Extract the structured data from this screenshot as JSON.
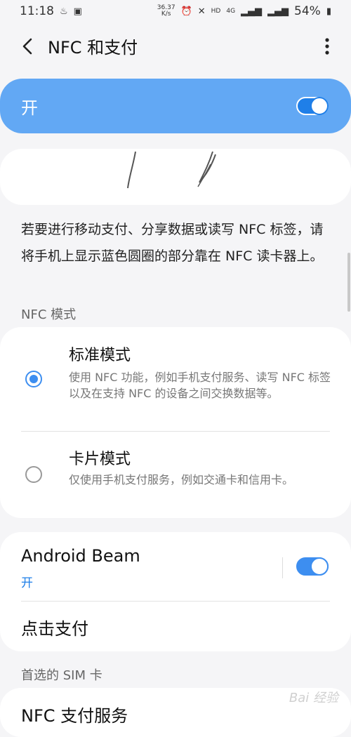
{
  "status_bar": {
    "time": "11:18",
    "net_speed_value": "36.37",
    "net_speed_unit": "K/s",
    "network_hd": "HD",
    "network_4g": "4G",
    "battery": "54%"
  },
  "header": {
    "title": "NFC 和支付"
  },
  "master_toggle": {
    "label": "开",
    "state": "on"
  },
  "description": "若要进行移动支付、分享数据或读写 NFC 标签，请将手机上显示蓝色圆圈的部分靠在 NFC 读卡器上。",
  "nfc_mode": {
    "header": "NFC 模式",
    "options": [
      {
        "title": "标准模式",
        "desc": "使用 NFC 功能，例如手机支付服务、读写 NFC 标签以及在支持 NFC 的设备之间交换数据等。",
        "selected": true
      },
      {
        "title": "卡片模式",
        "desc": "仅使用手机支付服务，例如交通卡和信用卡。",
        "selected": false
      }
    ]
  },
  "android_beam": {
    "title": "Android Beam",
    "status": "开",
    "state": "on"
  },
  "tap_pay": {
    "title": "点击支付"
  },
  "sim": {
    "header": "首选的 SIM 卡"
  },
  "payment_service": {
    "title": "NFC 支付服务"
  },
  "watermark": "Bai 经验",
  "colors": {
    "accent": "#3d8ef0",
    "toggle_card": "#62a8f4",
    "background": "#f5f5f7"
  }
}
